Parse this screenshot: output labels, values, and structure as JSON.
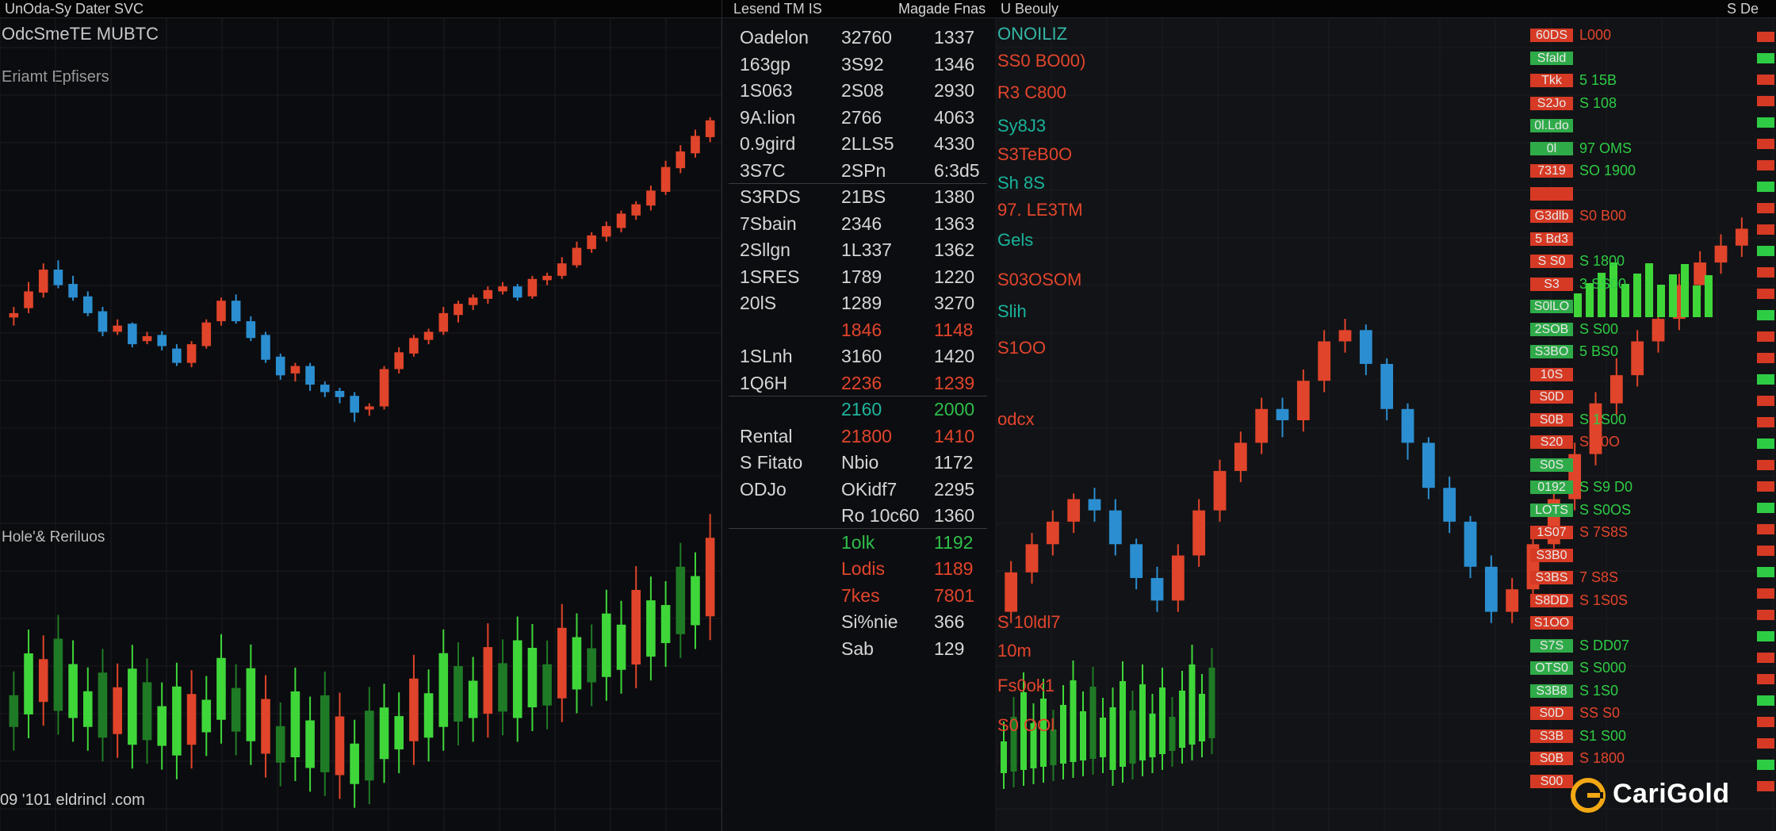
{
  "topbar": {
    "left_title": "UnOda-Sy Dater SVC",
    "mid_title": "Lesend TM IS",
    "mid_sub": "Magade Fnas",
    "right_title": "U Beouly",
    "right_corner": "S De"
  },
  "left_panel": {
    "title": "OdcSmeTE MUBTC",
    "subtitle": "Eriamt Epfisers",
    "lower_label": "Hole'& Reriluos",
    "footer": "09 '101 eldrincl .com"
  },
  "mid_panel": {
    "rows": [
      {
        "c1": "Oadelon",
        "c2": "32760",
        "c3": "1337"
      },
      {
        "c1": "163gp",
        "c2": "3S92",
        "c3": "1346"
      },
      {
        "c1": "1S063",
        "c2": "2S08",
        "c3": "2930"
      },
      {
        "c1": "9A:lion",
        "c2": "2766",
        "c3": "4063"
      },
      {
        "c1": "0.9gird",
        "c2": "2LLS5",
        "c3": "4330"
      },
      {
        "c1": "3S7C",
        "c2": "2SPn",
        "c3": "6:3d5"
      },
      {
        "c1": "S3RDS",
        "c2": "21BS",
        "c3": "1380"
      },
      {
        "c1": "7Sbain",
        "c2": "2346",
        "c3": "1363"
      },
      {
        "c1": "2Sllgn",
        "c2": "1L337",
        "c3": "1362"
      },
      {
        "c1": "1SRES",
        "c2": "1789",
        "c3": "1220"
      },
      {
        "c1": "20lS",
        "c2": "1289",
        "c3": "3270"
      },
      {
        "c1": "",
        "c2": "1846",
        "c3": "1148"
      },
      {
        "c1": "1SLnh",
        "c2": "3160",
        "c3": "1420"
      },
      {
        "c1": "1Q6H",
        "c2": "2236",
        "c3": "1239"
      },
      {
        "c1": "",
        "c2": "2160",
        "c3": "2000"
      },
      {
        "c1": "Rental",
        "c2": "21800",
        "c3": "1410"
      },
      {
        "c1": "S Fitato",
        "c2": "Nbio",
        "c3": "1172"
      },
      {
        "c1": "ODJo",
        "c2": "OKidf7",
        "c3": "2295"
      },
      {
        "c1": "",
        "c2": "Ro 10c60",
        "c3": "1360"
      },
      {
        "c1": "",
        "c2": "1olk",
        "c3": "1192"
      },
      {
        "c1": "",
        "c2": "Lodis",
        "c3": "1189"
      },
      {
        "c1": "",
        "c2": "7kes",
        "c3": "7801"
      },
      {
        "c1": "",
        "c2": "Si%nie",
        "c3": "366"
      },
      {
        "c1": "",
        "c2": "Sab",
        "c3": "129"
      }
    ]
  },
  "right_panel": {
    "labels": [
      {
        "text": "ONOILIZ",
        "color": "#34b7a7"
      },
      {
        "text": "SS0 BO00)",
        "color": "#e2452c"
      },
      {
        "text": "R3 C800",
        "color": "#e2452c"
      },
      {
        "text": "Sy8J3",
        "color": "#19b39b"
      },
      {
        "text": "S3TeB0O",
        "color": "#e2452c"
      },
      {
        "text": "Sh 8S",
        "color": "#19b39b"
      },
      {
        "text": "97. LE3TM",
        "color": "#e2452c"
      },
      {
        "text": "Gels",
        "color": "#19b39b"
      },
      {
        "text": "S03OSOM",
        "color": "#e2452c"
      },
      {
        "text": "Slih",
        "color": "#19b39b"
      },
      {
        "text": "S1OO",
        "color": "#e2452c"
      },
      {
        "text": "odcx",
        "color": "#e2452c"
      },
      {
        "text": "S 10ldl7",
        "color": "#e2452c"
      },
      {
        "text": "10m",
        "color": "#e2452c"
      },
      {
        "text": "Fs0ok1",
        "color": "#e2452c"
      },
      {
        "text": "S0 OOl",
        "color": "#e2452c"
      }
    ],
    "orderbook": [
      {
        "price": "60DS",
        "vol": "L000",
        "pc": "#d63a24",
        "vc": "#e2452c"
      },
      {
        "price": "Sfald",
        "vol": "",
        "pc": "#2faa49",
        "vc": "#2ecc45"
      },
      {
        "price": "Tkk",
        "vol": "5 15B",
        "pc": "#d63a24",
        "vc": "#2ecc45"
      },
      {
        "price": "S2Jo",
        "vol": "S 108",
        "pc": "#d63a24",
        "vc": "#2ecc45"
      },
      {
        "price": "0l.Ldo",
        "vol": "",
        "pc": "#2faa49",
        "vc": "#2ecc45"
      },
      {
        "price": "0l",
        "vol": "97 OMS",
        "pc": "#2faa49",
        "vc": "#2ecc45"
      },
      {
        "price": "7319",
        "vol": "SO 1900",
        "pc": "#d63a24",
        "vc": "#2ecc45"
      },
      {
        "price": "",
        "vol": "",
        "pc": "#d63a24",
        "vc": "#2ecc45"
      },
      {
        "price": "G3dlb",
        "vol": "S0 B00",
        "pc": "#d63a24",
        "vc": "#e2452c"
      },
      {
        "price": "5 Bd3",
        "vol": "",
        "pc": "#d63a24",
        "vc": "#2ecc45"
      },
      {
        "price": "S S0",
        "vol": "S 1800",
        "pc": "#d63a24",
        "vc": "#2ecc45"
      },
      {
        "price": "S3",
        "vol": "3 SS00",
        "pc": "#d63a24",
        "vc": "#2ecc45"
      },
      {
        "price": "S0lLO",
        "vol": "",
        "pc": "#2faa49",
        "vc": "#2ecc45"
      },
      {
        "price": "2SOB",
        "vol": "S S00",
        "pc": "#2faa49",
        "vc": "#2ecc45"
      },
      {
        "price": "S3BO",
        "vol": "5 BS0",
        "pc": "#2faa49",
        "vc": "#2ecc45"
      },
      {
        "price": "10S",
        "vol": "",
        "pc": "#d63a24",
        "vc": "#2ecc45"
      },
      {
        "price": "S0D",
        "vol": "",
        "pc": "#d63a24",
        "vc": "#e2452c"
      },
      {
        "price": "S0B",
        "vol": "S 1S00",
        "pc": "#d63a24",
        "vc": "#2ecc45"
      },
      {
        "price": "S20",
        "vol": "S 80O",
        "pc": "#d63a24",
        "vc": "#e2452c"
      },
      {
        "price": "S0S",
        "vol": "",
        "pc": "#2faa49",
        "vc": "#2ecc45"
      },
      {
        "price": "0192",
        "vol": "S S9 D0",
        "pc": "#2faa49",
        "vc": "#2ecc45"
      },
      {
        "price": "LOTS",
        "vol": "S S0OS",
        "pc": "#2faa49",
        "vc": "#2ecc45"
      },
      {
        "price": "1S07",
        "vol": "S 7S8S",
        "pc": "#d63a24",
        "vc": "#e2452c"
      },
      {
        "price": "S3B0",
        "vol": "",
        "pc": "#d63a24",
        "vc": "#e2452c"
      },
      {
        "price": "S3BS",
        "vol": "7 S8S",
        "pc": "#d63a24",
        "vc": "#e2452c"
      },
      {
        "price": "S8DD",
        "vol": "S 1S0S",
        "pc": "#d63a24",
        "vc": "#e2452c"
      },
      {
        "price": "S1OO",
        "vol": "",
        "pc": "#d63a24",
        "vc": "#e2452c"
      },
      {
        "price": "S7S",
        "vol": "S DD07",
        "pc": "#2faa49",
        "vc": "#2ecc45"
      },
      {
        "price": "OTS0",
        "vol": "S S000",
        "pc": "#2faa49",
        "vc": "#2ecc45"
      },
      {
        "price": "S3B8",
        "vol": "S 1S0",
        "pc": "#2faa49",
        "vc": "#2ecc45"
      },
      {
        "price": "S0D",
        "vol": "SS S0",
        "pc": "#d63a24",
        "vc": "#e2452c"
      },
      {
        "price": "S3B",
        "vol": "S1 S00",
        "pc": "#d63a24",
        "vc": "#2ecc45"
      },
      {
        "price": "S0B",
        "vol": "S 1800",
        "pc": "#d63a24",
        "vc": "#e2452c"
      },
      {
        "price": "S00",
        "vol": "",
        "pc": "#d63a24",
        "vc": "#e2452c"
      }
    ]
  },
  "logo": {
    "text": "CariGold"
  },
  "colors": {
    "up_red": "#e0442a",
    "down_blue": "#2b8ed0",
    "volume_green": "#3fd63a",
    "volume_dark": "#1f7a25",
    "gold": "#f1a814"
  },
  "chart_data": [
    {
      "type": "candlestick",
      "title": "",
      "series": [
        {
          "values": [
            [
              268,
              275,
              255,
              285
            ],
            [
              283,
              310,
              275,
              325
            ],
            [
              308,
              345,
              300,
              355
            ],
            [
              345,
              320,
              315,
              360
            ],
            [
              322,
              300,
              295,
              335
            ],
            [
              302,
              275,
              270,
              310
            ],
            [
              278,
              245,
              238,
              285
            ],
            [
              245,
              255,
              240,
              265
            ],
            [
              258,
              225,
              220,
              260
            ],
            [
              230,
              238,
              225,
              245
            ],
            [
              240,
              222,
              215,
              246
            ],
            [
              218,
              195,
              190,
              225
            ],
            [
              195,
              225,
              188,
              230
            ],
            [
              222,
              260,
              218,
              265
            ],
            [
              262,
              295,
              255,
              300
            ],
            [
              295,
              262,
              258,
              305
            ],
            [
              262,
              235,
              230,
              270
            ],
            [
              240,
              200,
              195,
              245
            ],
            [
              205,
              175,
              168,
              210
            ],
            [
              178,
              190,
              165,
              195
            ],
            [
              190,
              160,
              150,
              195
            ],
            [
              160,
              148,
              140,
              165
            ],
            [
              150,
              140,
              130,
              155
            ],
            [
              142,
              115,
              100,
              148
            ],
            [
              120,
              125,
              110,
              130
            ],
            [
              125,
              185,
              120,
              190
            ],
            [
              185,
              212,
              178,
              220
            ],
            [
              210,
              235,
              205,
              240
            ],
            [
              232,
              245,
              225,
              250
            ],
            [
              245,
              275,
              240,
              285
            ],
            [
              272,
              290,
              260,
              295
            ],
            [
              288,
              300,
              280,
              305
            ],
            [
              298,
              312,
              290,
              318
            ],
            [
              310,
              318,
              305,
              325
            ],
            [
              318,
              300,
              295,
              322
            ],
            [
              302,
              330,
              298,
              335
            ],
            [
              328,
              335,
              320,
              340
            ],
            [
              335,
              355,
              330,
              365
            ],
            [
              352,
              380,
              348,
              390
            ],
            [
              378,
              400,
              372,
              405
            ],
            [
              398,
              415,
              390,
              422
            ],
            [
              412,
              435,
              405,
              440
            ],
            [
              432,
              450,
              425,
              455
            ],
            [
              448,
              472,
              440,
              480
            ],
            [
              470,
              510,
              465,
              520
            ],
            [
              508,
              535,
              500,
              545
            ],
            [
              532,
              560,
              525,
              570
            ],
            [
              558,
              585,
              550,
              590
            ]
          ]
        }
      ]
    },
    {
      "type": "candlestick",
      "title": "",
      "series": [
        {
          "values": [
            [
              60,
              95,
              50,
              105
            ],
            [
              95,
              120,
              85,
              130
            ],
            [
              120,
              140,
              110,
              150
            ],
            [
              140,
              160,
              130,
              165
            ],
            [
              160,
              150,
              140,
              170
            ],
            [
              150,
              120,
              110,
              160
            ],
            [
              120,
              90,
              80,
              125
            ],
            [
              90,
              70,
              60,
              100
            ],
            [
              70,
              110,
              60,
              120
            ],
            [
              110,
              150,
              100,
              160
            ],
            [
              150,
              185,
              140,
              195
            ],
            [
              185,
              210,
              175,
              220
            ],
            [
              210,
              240,
              200,
              250
            ],
            [
              240,
              230,
              215,
              250
            ],
            [
              230,
              265,
              220,
              275
            ],
            [
              265,
              300,
              255,
              310
            ],
            [
              300,
              310,
              290,
              320
            ],
            [
              310,
              280,
              270,
              315
            ],
            [
              280,
              240,
              230,
              285
            ],
            [
              240,
              210,
              195,
              245
            ],
            [
              210,
              170,
              160,
              215
            ],
            [
              170,
              140,
              130,
              180
            ],
            [
              140,
              100,
              90,
              145
            ],
            [
              100,
              60,
              50,
              110
            ],
            [
              60,
              80,
              50,
              90
            ],
            [
              80,
              120,
              70,
              130
            ],
            [
              120,
              160,
              110,
              170
            ],
            [
              160,
              200,
              150,
              210
            ],
            [
              200,
              245,
              190,
              255
            ],
            [
              245,
              270,
              235,
              285
            ],
            [
              270,
              300,
              260,
              310
            ],
            [
              300,
              320,
              290,
              330
            ],
            [
              320,
              350,
              310,
              360
            ],
            [
              350,
              370,
              340,
              380
            ],
            [
              370,
              385,
              360,
              395
            ],
            [
              385,
              400,
              375,
              410
            ]
          ]
        }
      ]
    }
  ]
}
